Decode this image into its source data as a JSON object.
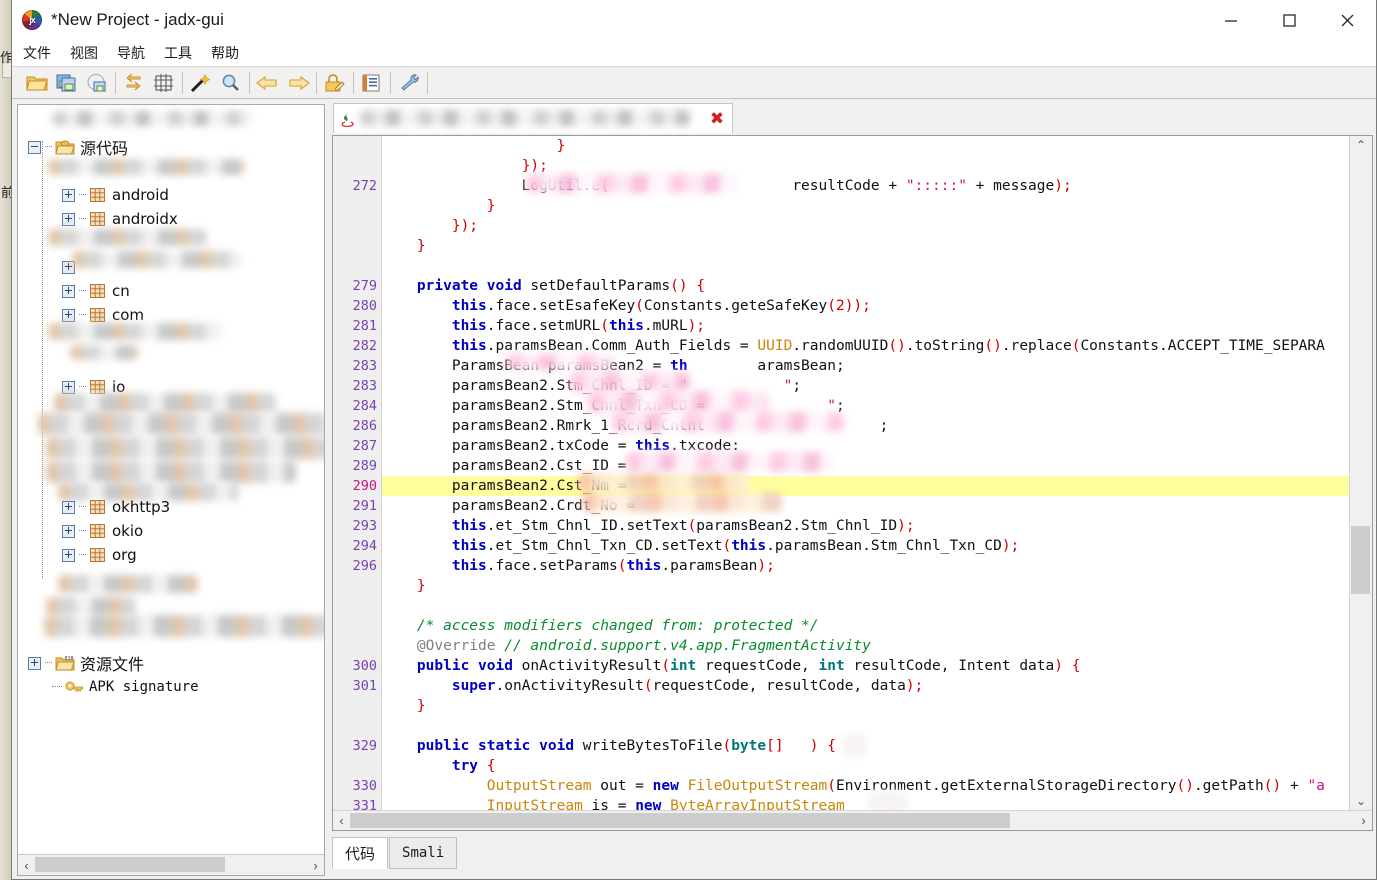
{
  "window": {
    "title": "*New Project - jadx-gui",
    "app_icon": "jadx-logo-icon",
    "controls": {
      "minimize": "minimize-icon",
      "maximize": "maximize-icon",
      "close": "close-icon"
    }
  },
  "menubar": {
    "items": [
      {
        "label": "文件",
        "name": "menu-file"
      },
      {
        "label": "视图",
        "name": "menu-view"
      },
      {
        "label": "导航",
        "name": "menu-navigation"
      },
      {
        "label": "工具",
        "name": "menu-tools"
      },
      {
        "label": "帮助",
        "name": "menu-help"
      }
    ]
  },
  "toolbar": {
    "buttons": [
      {
        "name": "open-file-icon",
        "tip": "打开文件"
      },
      {
        "name": "save-all-icon",
        "tip": "保存全部"
      },
      {
        "name": "export-gradle-icon",
        "tip": "导出 Gradle 项目"
      },
      {
        "name": "sync-icon",
        "tip": "同步"
      },
      {
        "name": "flat-packages-icon",
        "tip": "平铺包"
      },
      {
        "name": "search-magic-icon",
        "tip": "全文搜索"
      },
      {
        "name": "find-icon",
        "tip": "查找"
      },
      {
        "name": "back-arrow-icon",
        "tip": "后退"
      },
      {
        "name": "forward-arrow-icon",
        "tip": "前进"
      },
      {
        "name": "deobfuscation-icon",
        "tip": "反混淆"
      },
      {
        "name": "log-icon",
        "tip": "日志"
      },
      {
        "name": "preferences-icon",
        "tip": "首选项"
      }
    ]
  },
  "background_window": {
    "visible_text": "作",
    "visible_text2": "前"
  },
  "tree": {
    "nodes": [
      {
        "label": "",
        "indent": 0,
        "icon": "redacted",
        "expander": "none",
        "redacted": true
      },
      {
        "label": "源代码",
        "indent": 0,
        "icon": "source-folder-icon",
        "expander": "minus",
        "redacted": false
      },
      {
        "label": "",
        "indent": 1,
        "icon": "package-icon",
        "expander": "plus",
        "redacted": true
      },
      {
        "label": "android",
        "indent": 1,
        "icon": "package-icon",
        "expander": "plus",
        "redacted": false
      },
      {
        "label": "androidx",
        "indent": 1,
        "icon": "package-icon",
        "expander": "plus",
        "redacted": false
      },
      {
        "label": "",
        "indent": 1,
        "icon": "package-icon",
        "expander": "plus",
        "redacted": true
      },
      {
        "label": "",
        "indent": 1,
        "icon": "package-icon",
        "expander": "plus",
        "redacted": true
      },
      {
        "label": "cn",
        "indent": 1,
        "icon": "package-icon",
        "expander": "plus",
        "redacted": false
      },
      {
        "label": "com",
        "indent": 1,
        "icon": "package-icon",
        "expander": "plus",
        "redacted": false
      },
      {
        "label": "",
        "indent": 1,
        "icon": "package-icon",
        "expander": "plus",
        "redacted": true
      },
      {
        "label": "",
        "indent": 1,
        "icon": "package-icon",
        "expander": "plus",
        "redacted": true
      },
      {
        "label": "io",
        "indent": 1,
        "icon": "package-icon",
        "expander": "plus",
        "redacted": false
      },
      {
        "label": "",
        "indent": 1,
        "icon": "package-icon",
        "expander": "plus",
        "redacted": true
      },
      {
        "label": "",
        "indent": 1,
        "icon": "package-icon",
        "expander": "plus",
        "redacted": true
      },
      {
        "label": "",
        "indent": 1,
        "icon": "package-icon",
        "expander": "plus",
        "redacted": true
      },
      {
        "label": "",
        "indent": 1,
        "icon": "package-icon",
        "expander": "plus",
        "redacted": true
      },
      {
        "label": "okhttp3",
        "indent": 1,
        "icon": "package-icon",
        "expander": "plus",
        "redacted": false
      },
      {
        "label": "okio",
        "indent": 1,
        "icon": "package-icon",
        "expander": "plus",
        "redacted": false
      },
      {
        "label": "org",
        "indent": 1,
        "icon": "package-icon",
        "expander": "plus",
        "redacted": false
      },
      {
        "label": "",
        "indent": 1,
        "icon": "package-icon",
        "expander": "plus",
        "redacted": true
      },
      {
        "label": "",
        "indent": 1,
        "icon": "package-icon",
        "expander": "plus",
        "redacted": true
      },
      {
        "label": "资源文件",
        "indent": 0,
        "icon": "resources-folder-icon",
        "expander": "plus",
        "redacted": false
      },
      {
        "label": "APK signature",
        "indent": 0,
        "icon": "key-icon",
        "expander": "none",
        "redacted": false
      }
    ],
    "hscroll": {
      "left_arrow": "‹",
      "right_arrow": "›"
    }
  },
  "editor": {
    "tab": {
      "icon": "java-class-icon",
      "title": "",
      "title_redacted": true,
      "close": "✖"
    },
    "current_line": 290,
    "lines": [
      {
        "num": "",
        "code": "                    }"
      },
      {
        "num": "",
        "code": "                });"
      },
      {
        "num": "272",
        "code": "                LogUtil.e(                     resultCode + \":::::\" + message);"
      },
      {
        "num": "",
        "code": "            }"
      },
      {
        "num": "",
        "code": "        });"
      },
      {
        "num": "",
        "code": "    }"
      },
      {
        "num": "",
        "code": ""
      },
      {
        "num": "279",
        "code": "    private void setDefaultParams() {"
      },
      {
        "num": "280",
        "code": "        this.face.setEsafeKey(Constants.geteSafeKey(2));"
      },
      {
        "num": "281",
        "code": "        this.face.setmURL(this.mURL);"
      },
      {
        "num": "282",
        "code": "        this.paramsBean.Comm_Auth_Fields = UUID.randomUUID().toString().replace(Constants.ACCEPT_TIME_SEPARA"
      },
      {
        "num": "283",
        "code": "        ParamsBean paramsBean2 = this.    paramsBean;"
      },
      {
        "num": "283",
        "code": "        paramsBean2.Stm_Chnl_ID = \"           \";"
      },
      {
        "num": "284",
        "code": "        paramsBean2.Stm_Chnl_Txn_CD = \"            \";"
      },
      {
        "num": "286",
        "code": "        paramsBean2.Rmrk_1_Rcrd_Cntnt                      ;"
      },
      {
        "num": "287",
        "code": "        paramsBean2.txCode = this.txcode:"
      },
      {
        "num": "289",
        "code": "        paramsBean2.Cst_ID =                      ;"
      },
      {
        "num": "290",
        "code": "        paramsBean2.Cst_Nm =                      ;"
      },
      {
        "num": "291",
        "code": "        paramsBean2.Crdt_No =                     ;"
      },
      {
        "num": "293",
        "code": "        this.et_Stm_Chnl_ID.setText(paramsBean2.Stm_Chnl_ID);"
      },
      {
        "num": "294",
        "code": "        this.et_Stm_Chnl_Txn_CD.setText(this.paramsBean.Stm_Chnl_Txn_CD);"
      },
      {
        "num": "296",
        "code": "        this.face.setParams(this.paramsBean);"
      },
      {
        "num": "",
        "code": "    }"
      },
      {
        "num": "",
        "code": ""
      },
      {
        "num": "",
        "code": "    /* access modifiers changed from: protected */"
      },
      {
        "num": "",
        "code": "    @Override // android.support.v4.app.FragmentActivity"
      },
      {
        "num": "300",
        "code": "    public void onActivityResult(int requestCode, int resultCode, Intent data) {"
      },
      {
        "num": "301",
        "code": "        super.onActivityResult(requestCode, resultCode, data);"
      },
      {
        "num": "",
        "code": "    }"
      },
      {
        "num": "",
        "code": ""
      },
      {
        "num": "329",
        "code": "    public static void writeBytesToFile(byte[]   ) {"
      },
      {
        "num": "",
        "code": "        try {"
      },
      {
        "num": "330",
        "code": "            OutputStream out = new FileOutputStream(Environment.getExternalStorageDirectory().getPath() + \"a"
      },
      {
        "num": "331",
        "code": "            InputStream is = new ByteArrayInputStream     ;"
      }
    ],
    "scrollbars": {
      "v_up": "⌃",
      "v_down": "⌄",
      "h_left": "‹",
      "h_right": "›"
    }
  },
  "bottom_tabs": [
    {
      "label": "代码",
      "active": true,
      "name": "tab-code"
    },
    {
      "label": "Smali",
      "active": false,
      "name": "tab-smali"
    }
  ],
  "colors": {
    "highlight_line": "#ffff9e",
    "keyword": "#0000c0",
    "string": "#c71585",
    "comment": "#0b8a2f",
    "type": "#c8860a",
    "linenum": "#7a3fb0",
    "accent_close": "#cc2222"
  }
}
